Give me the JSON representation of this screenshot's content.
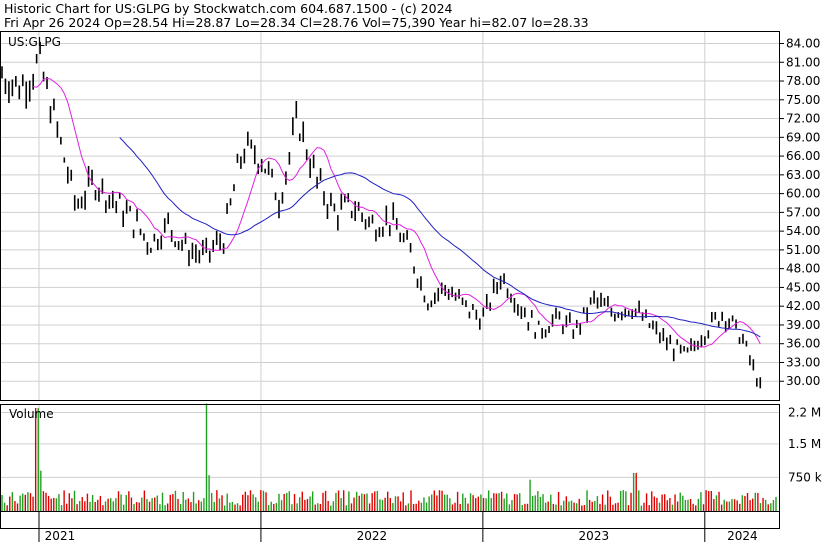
{
  "header": {
    "line1": "Historic Chart for US:GLPG by Stockwatch.com 604.687.1500 - (c) 2024",
    "line2": "Fri Apr 26 2024  Op=28.54  Hi=28.87  Lo=28.34  Cl=28.76  Vol=75,390  Year hi=82.07  lo=28.33"
  },
  "chart_data": {
    "type": "line",
    "price_panel": {
      "label": "US:GLPG",
      "ylim": [
        27,
        86
      ],
      "y_ticks": [
        30,
        33,
        36,
        39,
        42,
        45,
        48,
        51,
        54,
        57,
        60,
        63,
        66,
        69,
        72,
        75,
        78,
        81,
        84
      ],
      "grid": true,
      "series": [
        {
          "kind": "ohlc",
          "color": "#000000",
          "x": [
            "2020-11",
            "2020-12",
            "2021-01",
            "2021-02",
            "2021-03",
            "2021-04",
            "2021-05",
            "2021-06",
            "2021-07",
            "2021-08",
            "2021-09",
            "2021-10",
            "2021-11",
            "2021-12",
            "2022-01",
            "2022-02",
            "2022-03",
            "2022-04",
            "2022-05",
            "2022-06",
            "2022-07",
            "2022-08",
            "2022-09",
            "2022-10",
            "2022-11",
            "2022-12",
            "2023-01",
            "2023-02",
            "2023-03",
            "2023-04",
            "2023-05",
            "2023-06",
            "2023-07",
            "2023-08",
            "2023-09",
            "2023-10",
            "2023-11",
            "2023-12",
            "2024-01",
            "2024-02",
            "2024-03",
            "2024-04"
          ],
          "y": [
            79,
            77,
            81,
            70,
            58,
            62,
            59,
            56,
            52,
            55,
            51,
            50,
            53,
            67,
            66,
            59,
            72,
            62,
            57,
            58,
            55,
            56,
            51,
            43,
            45,
            42,
            40,
            47,
            42,
            38,
            40,
            38,
            43,
            41,
            42,
            39,
            36,
            34,
            38,
            41,
            37,
            29
          ]
        },
        {
          "kind": "moving-average",
          "color": "#e020e0"
        },
        {
          "kind": "moving-average",
          "color": "#2020c0"
        }
      ]
    },
    "volume_panel": {
      "label": "Volume",
      "y_ticks": [
        "2.2 M",
        "1.5 M",
        "750 k"
      ],
      "max_values_m": 2.3,
      "up_color": "#20a020",
      "down_color": "#e00000"
    },
    "x_axis": {
      "tick_labels": [
        "2021",
        "2022",
        "2023",
        "2024"
      ]
    }
  }
}
